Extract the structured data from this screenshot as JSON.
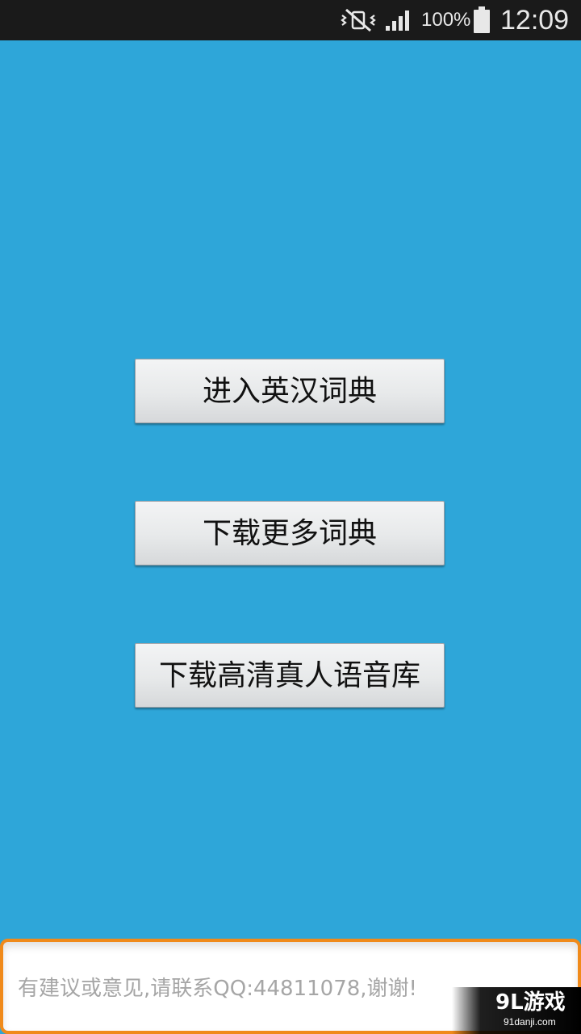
{
  "status_bar": {
    "icons": [
      "mute-vibrate-icon",
      "signal-icon",
      "battery-icon"
    ],
    "battery_percent": "100%",
    "time": "12:09"
  },
  "main": {
    "buttons": [
      {
        "label": "进入英汉词典"
      },
      {
        "label": "下载更多词典"
      },
      {
        "label": "下载高清真人语音库"
      }
    ]
  },
  "feedback": {
    "placeholder": "有建议或意见,请联系QQ:44811078,谢谢!"
  },
  "watermark": {
    "main": "9L游戏",
    "sub": "91danji.com"
  },
  "colors": {
    "background": "#2ea6d9",
    "status_bar": "#1a1a1a",
    "button_face": "#e7e9ea",
    "field_border": "#f08a1a"
  }
}
